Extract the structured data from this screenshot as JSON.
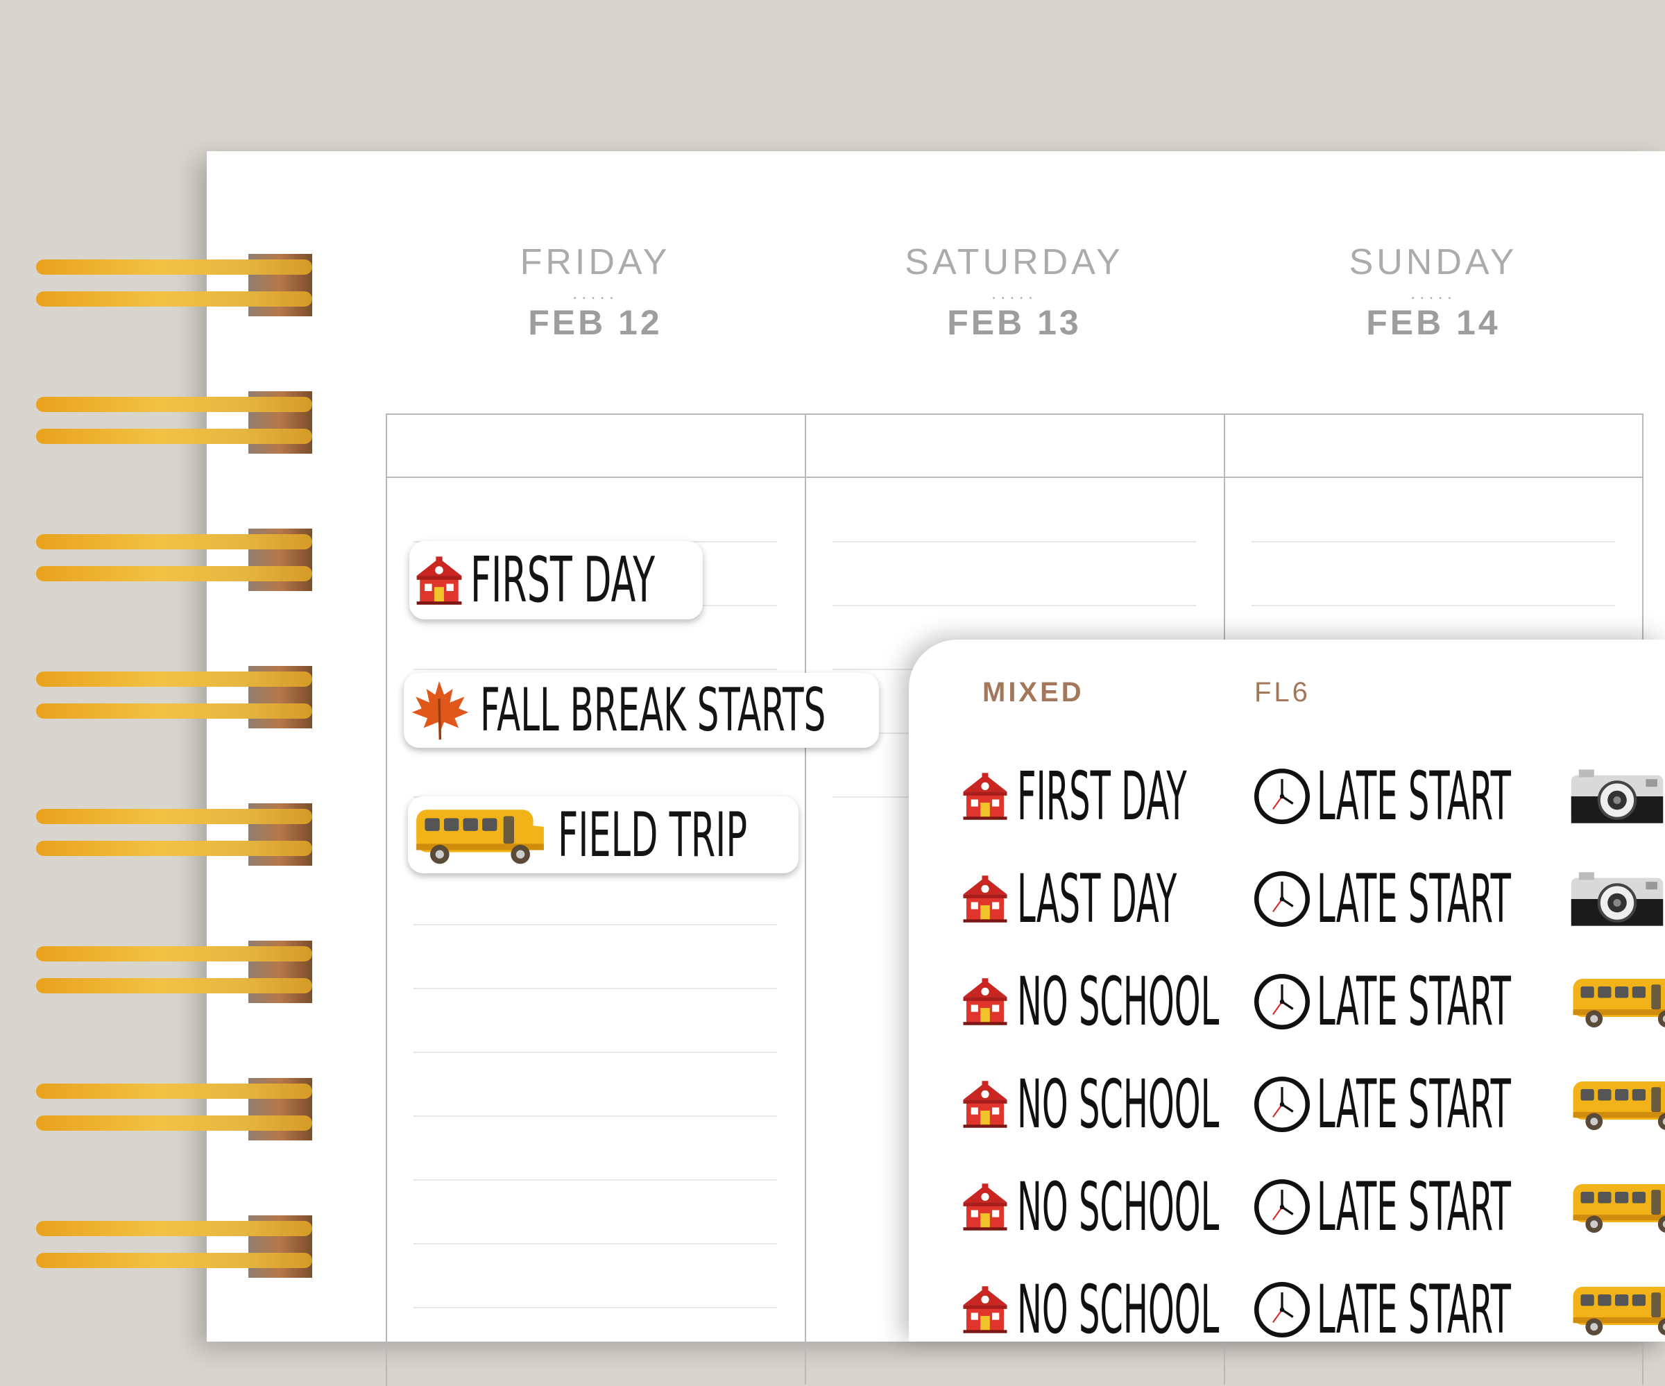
{
  "days": [
    {
      "name": "FRIDAY",
      "dots": ".....",
      "date": "FEB 12"
    },
    {
      "name": "SATURDAY",
      "dots": ".....",
      "date": "FEB 13"
    },
    {
      "name": "SUNDAY",
      "dots": ".....",
      "date": "FEB 14"
    }
  ],
  "placed_stickers": [
    {
      "icon": "schoolhouse-icon",
      "label": "FIRST DAY"
    },
    {
      "icon": "maple-leaf-icon",
      "label": "FALL BREAK STARTS"
    },
    {
      "icon": "school-bus-icon",
      "label": "FIELD TRIP"
    }
  ],
  "sheet": {
    "category": "MIXED",
    "code": "FL6",
    "col1": [
      "FIRST DAY",
      "LAST DAY",
      "NO SCHOOL",
      "NO SCHOOL",
      "NO SCHOOL",
      "NO SCHOOL"
    ],
    "col2": [
      "LATE START",
      "LATE START",
      "LATE START",
      "LATE START",
      "LATE START",
      "LATE START"
    ],
    "col3_icons": [
      "camera-icon",
      "camera-icon",
      "school-bus-icon",
      "school-bus-icon",
      "school-bus-icon",
      "school-bus-icon"
    ]
  },
  "colors": {
    "ring_gold": "#e8a823",
    "heading_gray": "#ababab",
    "sheet_brown": "#a3785a",
    "school_red": "#d9302a",
    "bus_yellow": "#f2b318",
    "leaf_orange": "#e0571b"
  }
}
